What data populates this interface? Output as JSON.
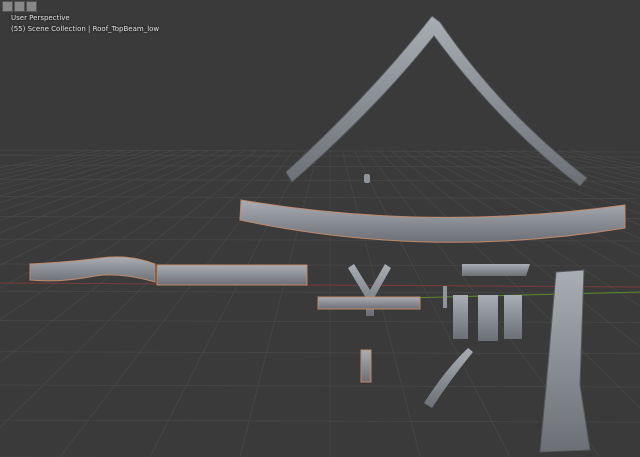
{
  "viewport": {
    "view_name": "User Perspective",
    "collection_info": "(55) Scene Collection | Roof_TopBeam_low"
  },
  "toolbar": {
    "icons": [
      "object-mode-icon",
      "shading-icon",
      "overlay-icon"
    ]
  },
  "colors": {
    "background": "#3a3a3a",
    "grid": "#474747",
    "x_axis": "#8a3a3a",
    "y_axis": "#5a8a2a",
    "mesh": "#8f949a"
  }
}
